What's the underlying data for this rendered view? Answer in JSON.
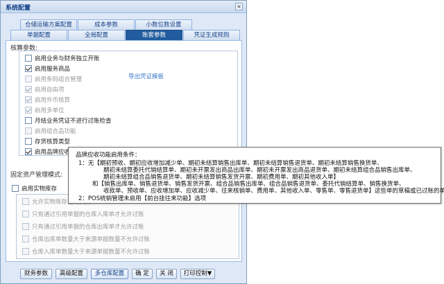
{
  "window": {
    "title": "系统配置",
    "close_label": "×"
  },
  "tabs": {
    "row1": [
      "仓储运输方案配置",
      "成本参数",
      "小数位数设置"
    ],
    "row2": [
      "单据配置",
      "全局配置",
      "账套参数",
      "凭证生成规则"
    ],
    "active_tab": "账套参数"
  },
  "accounting": {
    "section_label": "核算参数:",
    "options": [
      {
        "label": "启用业务与财务独立开账",
        "checked": false,
        "disabled": false
      },
      {
        "label": "启用服务商品",
        "checked": true,
        "disabled": false
      },
      {
        "label": "启用条码组合管理",
        "checked": false,
        "disabled": true
      },
      {
        "label": "启用自由项",
        "checked": true,
        "disabled": true
      },
      {
        "label": "启用外币核算",
        "checked": true,
        "disabled": true
      },
      {
        "label": "启用多单位",
        "checked": true,
        "disabled": true
      },
      {
        "label": "月结业务凭证不进行过账检查",
        "checked": false,
        "disabled": false
      },
      {
        "label": "启用组合品功能",
        "checked": false,
        "disabled": true
      },
      {
        "label": "存货核算类型",
        "checked": false,
        "disabled": false
      },
      {
        "label": "启用品牌应收功能",
        "checked": true,
        "disabled": false
      }
    ],
    "export_link": "导出凭证模板"
  },
  "fixed_asset": {
    "label": "固定资产管理模式:"
  },
  "warehouse": {
    "enable_label": "启用实物库存",
    "sub_options": [
      "允许实物库存出现负数",
      "只有通过引用单据的仓库入库单才允许过账",
      "只有通过引用单据的仓库出库单才允许过账",
      "仓库出库单数量大于来源单据数量不允许过账",
      "仓库入库单数量大于来源单据数量不允许过账"
    ]
  },
  "buttons": [
    "财务参数",
    "高级配置",
    "多仓库配置",
    "确 定",
    "关 闭",
    "打印控制▼"
  ],
  "tooltip": {
    "title": "品牌应收功能启用条件：",
    "lines": [
      "1：无【期初预收、期初应收增加减少单、期初未结算销售出库单、期初未结算销售退货单、期初未结算销售换货单、",
      "期初未结算委托代销结算单、期初未开票发出商品出库单、期初未开票发出商品退货单、期初未结算组合品销售出库单、",
      "期初未结算组合品销售退货单、期初未结算销售发货开票、期初费用单、期初其他收入单】",
      "和【销售出库单、销售退货单、销售发货开票、组合品销售出库单、组合品销售退货单、委托代销结算单、销售换货单、",
      "收款单、预收单、应收增加单、应收减少单、往来核销单、费用单、其他收入单、零售单、零售退货单】这些单的草稿或已过账的单据。",
      "2：POS统销管理未启用【前台挂往来功能】选项"
    ]
  }
}
